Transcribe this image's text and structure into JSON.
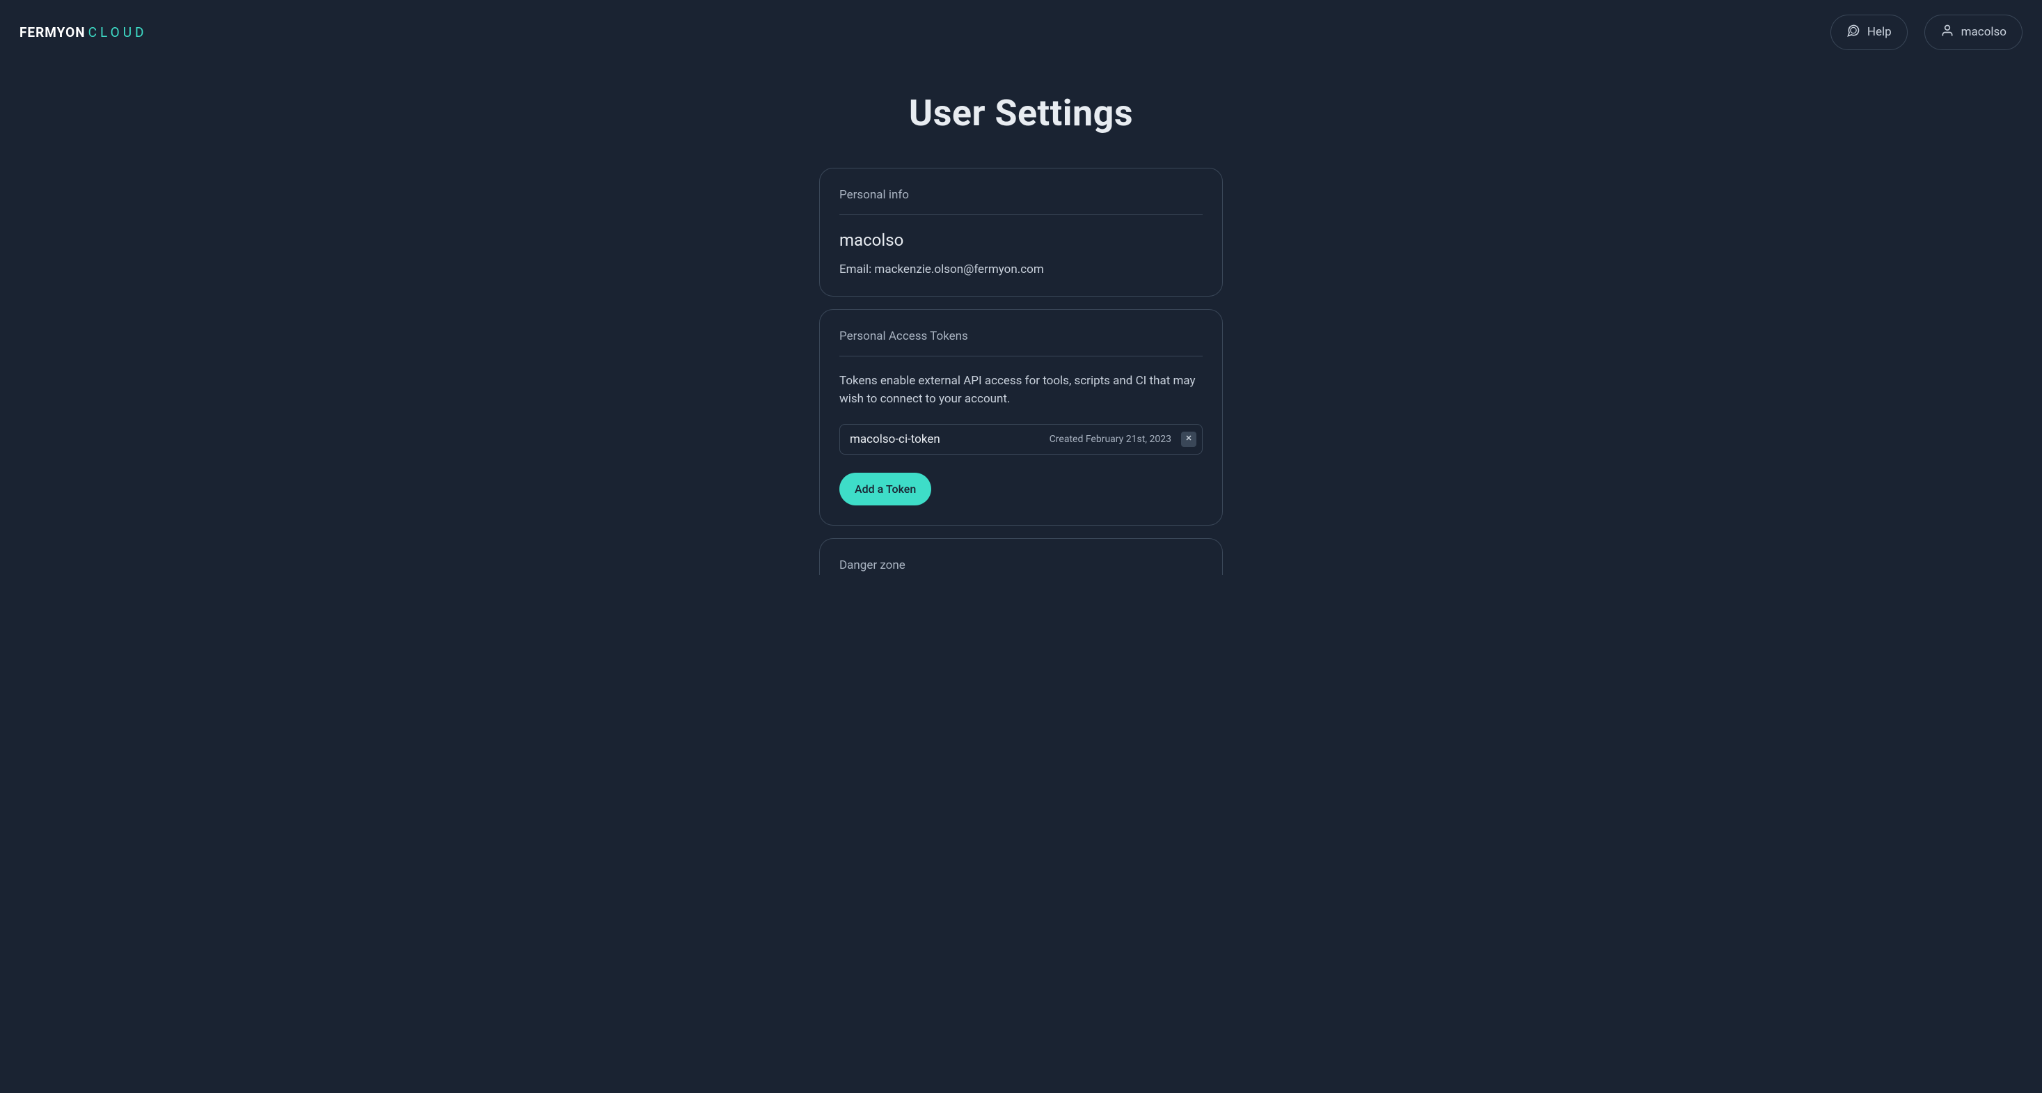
{
  "header": {
    "logo_primary": "FERMYON",
    "logo_secondary": "CLOUD",
    "help_label": "Help",
    "user_label": "macolso"
  },
  "page_title": "User Settings",
  "personal_info": {
    "heading": "Personal info",
    "username": "macolso",
    "email_label": "Email:",
    "email_value": "mackenzie.olson@fermyon.com"
  },
  "tokens": {
    "heading": "Personal Access Tokens",
    "description": "Tokens enable external API access for tools, scripts and CI that may wish to connect to your account.",
    "items": [
      {
        "name": "macolso-ci-token",
        "created": "Created February 21st, 2023"
      }
    ],
    "add_button_label": "Add a Token"
  },
  "danger_zone": {
    "heading": "Danger zone"
  },
  "colors": {
    "background": "#1a2332",
    "accent": "#3eddc8",
    "border": "#3a4758",
    "text_primary": "#e8ecf1",
    "text_secondary": "#c8d0db",
    "text_muted": "#a8b2c0"
  }
}
